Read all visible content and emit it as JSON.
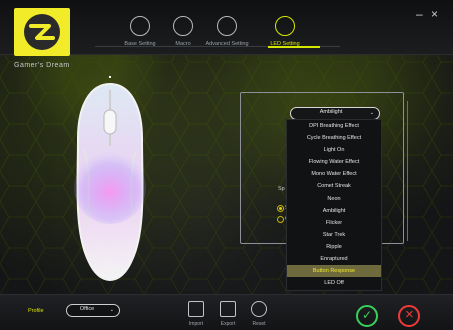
{
  "brand": {
    "tagline": "Gamer's Dream"
  },
  "tabs": [
    {
      "label": "Base Setting",
      "icon": "mouse-icon",
      "active": false
    },
    {
      "label": "Macro",
      "icon": "macro-m-icon",
      "active": false
    },
    {
      "label": "Advanced Setting",
      "icon": "wrench-icon",
      "active": false
    },
    {
      "label": "LED Setting",
      "icon": "bulb-icon",
      "active": true
    }
  ],
  "window": {
    "minimize": "–",
    "close": "×"
  },
  "led": {
    "effect_selected": "Ambilight",
    "effects": [
      "DPI Breathing Effect",
      "Cycle Breathing Effect",
      "Light On",
      "Flowing Water Effect",
      "Mono Water Effect",
      "Comet Streak",
      "Neon",
      "Ambilight",
      "Flicker",
      "Star Trek",
      "Ripple",
      "Enraptured",
      "Button Response",
      "LED Off"
    ],
    "highlighted_effect": "Button Response",
    "partial_speed_label": "Sp"
  },
  "bottom": {
    "profile_label": "Profile",
    "profile_value": "Office",
    "import_label": "Import",
    "export_label": "Export",
    "reset_label": "Reset"
  },
  "colors": {
    "accent": "#d5e800",
    "confirm": "#39d05a",
    "cancel": "#ef3a3a",
    "logo_bg": "#f2eb2a"
  }
}
